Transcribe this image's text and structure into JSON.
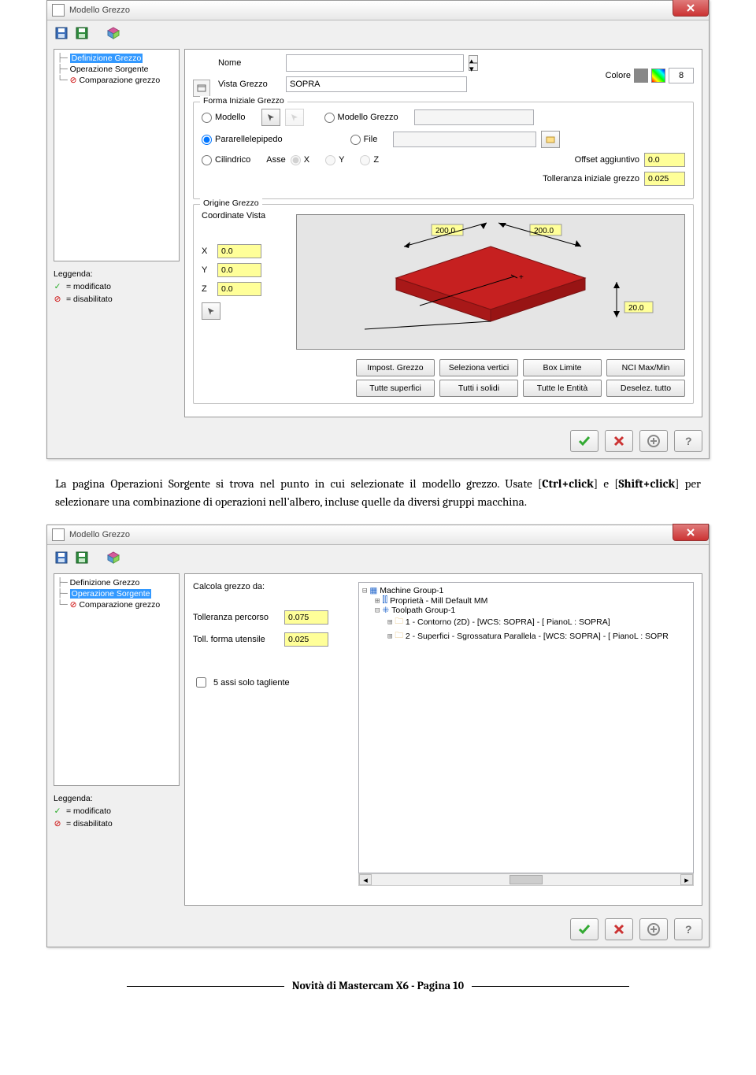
{
  "dialog1": {
    "title": "Modello Grezzo",
    "tree": {
      "items": [
        {
          "label": "Definizione Grezzo",
          "selected": true
        },
        {
          "label": "Operazione Sorgente"
        },
        {
          "label": "Comparazione grezzo",
          "disabled": true
        }
      ]
    },
    "legend": {
      "title": "Leggenda:",
      "modified": "= modificato",
      "disabled": "= disabilitato"
    },
    "nome_label": "Nome",
    "vista_label": "Vista Grezzo",
    "vista_value": "SOPRA",
    "colore_label": "Colore",
    "colore_value": "8",
    "forma_group": "Forma Iniziale Grezzo",
    "r_modello": "Modello",
    "r_modello_grezzo": "Modello Grezzo",
    "r_para": "Pararellelepipedo",
    "r_file": "File",
    "r_cilindrico": "Cilindrico",
    "asse_label": "Asse",
    "axis_x": "X",
    "axis_y": "Y",
    "axis_z": "Z",
    "offset_label": "Offset aggiuntivo",
    "offset_value": "0.0",
    "toll_label": "Tolleranza iniziale grezzo",
    "toll_value": "0.025",
    "origine_group": "Origine Grezzo",
    "coord_label": "Coordinate Vista",
    "x_val": "0.0",
    "y_val": "0.0",
    "z_val": "0.0",
    "dim_a": "200.0",
    "dim_b": "200.0",
    "dim_h": "20.0",
    "btns": {
      "imposta": "Impost. Grezzo",
      "seleziona": "Seleziona vertici",
      "box": "Box Limite",
      "nci": "NCI Max/Min",
      "superfici": "Tutte superfici",
      "solidi": "Tutti i solidi",
      "entita": "Tutte le Entità",
      "deselez": "Deselez. tutto"
    }
  },
  "paragraph": {
    "t1": "La pagina Operazioni Sorgente si trova nel punto in cui selezionate il modello grezzo. Usate [",
    "ctrl": "Ctrl+click",
    "t2": "] e [",
    "shift": "Shift+click",
    "t3": "] per selezionare una combinazione di operazioni nell'albero, incluse quelle da diversi gruppi macchina."
  },
  "dialog2": {
    "title": "Modello Grezzo",
    "tree": {
      "items": [
        {
          "label": "Definizione Grezzo"
        },
        {
          "label": "Operazione Sorgente",
          "selected": true
        },
        {
          "label": "Comparazione grezzo",
          "disabled": true
        }
      ]
    },
    "calc_label": "Calcola grezzo da:",
    "toll_p_label": "Tolleranza percorso",
    "toll_p_value": "0.075",
    "toll_u_label": "Toll. forma utensile",
    "toll_u_value": "0.025",
    "chk5": "5 assi solo tagliente",
    "machine_tree": {
      "root": "Machine Group-1",
      "prop": "Proprietà - Mill Default MM",
      "tg": "Toolpath Group-1",
      "op1": "1 - Contorno (2D) - [WCS: SOPRA] - [  PianoL  : SOPRA]",
      "op2": "2 - Superfici - Sgrossatura Parallela - [WCS: SOPRA] - [  PianoL  : SOPR"
    }
  },
  "footer": "Novità di Mastercam X6 - Pagina 10"
}
